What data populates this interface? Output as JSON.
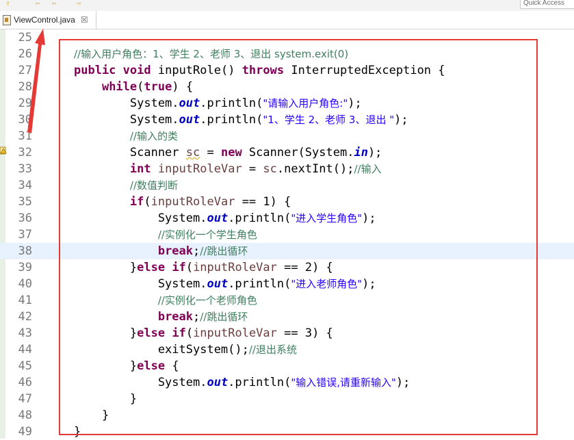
{
  "quick_access": {
    "placeholder": "Quick Access"
  },
  "tab": {
    "label": "ViewControl.java",
    "close_glyph": "☒"
  },
  "lines": [
    {
      "num": "25",
      "segs": []
    },
    {
      "num": "26",
      "segs": [
        {
          "c": "cm",
          "t": "//输入用户角色：1、学生 2、老师 3、退出 system.exit(0)"
        }
      ]
    },
    {
      "num": "27",
      "segs": [
        {
          "c": "kw",
          "t": "public"
        },
        {
          "c": "",
          "t": " "
        },
        {
          "c": "kw",
          "t": "void"
        },
        {
          "c": "",
          "t": " inputRole() "
        },
        {
          "c": "kw",
          "t": "throws"
        },
        {
          "c": "",
          "t": " InterruptedException {"
        }
      ]
    },
    {
      "num": "28",
      "segs": [
        {
          "c": "",
          "t": "    "
        },
        {
          "c": "kw",
          "t": "while"
        },
        {
          "c": "",
          "t": "("
        },
        {
          "c": "kw",
          "t": "true"
        },
        {
          "c": "",
          "t": ") {"
        }
      ]
    },
    {
      "num": "29",
      "segs": [
        {
          "c": "",
          "t": "        System."
        },
        {
          "c": "fld",
          "t": "out"
        },
        {
          "c": "",
          "t": ".println("
        },
        {
          "c": "str",
          "t": "\"请输入用户角色:\""
        },
        {
          "c": "",
          "t": ");"
        }
      ]
    },
    {
      "num": "30",
      "segs": [
        {
          "c": "",
          "t": "        System."
        },
        {
          "c": "fld",
          "t": "out"
        },
        {
          "c": "",
          "t": ".println("
        },
        {
          "c": "str",
          "t": "\"1、学生 2、老师 3、退出 \""
        },
        {
          "c": "",
          "t": ");"
        }
      ]
    },
    {
      "num": "31",
      "segs": [
        {
          "c": "",
          "t": "        "
        },
        {
          "c": "cm",
          "t": "//输入的类"
        }
      ]
    },
    {
      "num": "32",
      "segs": [
        {
          "c": "",
          "t": "        Scanner "
        },
        {
          "c": "var warn",
          "t": "sc"
        },
        {
          "c": "",
          "t": " = "
        },
        {
          "c": "kw",
          "t": "new"
        },
        {
          "c": "",
          "t": " Scanner(System."
        },
        {
          "c": "fld",
          "t": "in"
        },
        {
          "c": "",
          "t": ");"
        }
      ]
    },
    {
      "num": "33",
      "segs": [
        {
          "c": "",
          "t": "        "
        },
        {
          "c": "kw",
          "t": "int"
        },
        {
          "c": "",
          "t": " "
        },
        {
          "c": "var",
          "t": "inputRoleVar"
        },
        {
          "c": "",
          "t": " = "
        },
        {
          "c": "var",
          "t": "sc"
        },
        {
          "c": "",
          "t": ".nextInt();"
        },
        {
          "c": "cm",
          "t": "//输入"
        }
      ]
    },
    {
      "num": "34",
      "segs": [
        {
          "c": "",
          "t": "        "
        },
        {
          "c": "cm",
          "t": "//数值判断"
        }
      ]
    },
    {
      "num": "35",
      "segs": [
        {
          "c": "",
          "t": "        "
        },
        {
          "c": "kw",
          "t": "if"
        },
        {
          "c": "",
          "t": "("
        },
        {
          "c": "var",
          "t": "inputRoleVar"
        },
        {
          "c": "",
          "t": " == 1) {"
        }
      ]
    },
    {
      "num": "36",
      "segs": [
        {
          "c": "",
          "t": "            System."
        },
        {
          "c": "fld",
          "t": "out"
        },
        {
          "c": "",
          "t": ".println("
        },
        {
          "c": "str",
          "t": "\"进入学生角色\""
        },
        {
          "c": "",
          "t": ");"
        }
      ]
    },
    {
      "num": "37",
      "segs": [
        {
          "c": "",
          "t": "            "
        },
        {
          "c": "cm",
          "t": "//实例化一个学生角色"
        }
      ]
    },
    {
      "num": "38",
      "segs": [
        {
          "c": "",
          "t": "            "
        },
        {
          "c": "kw",
          "t": "break"
        },
        {
          "c": "",
          "t": ";"
        },
        {
          "c": "cm",
          "t": "//跳出循环"
        }
      ]
    },
    {
      "num": "39",
      "segs": [
        {
          "c": "",
          "t": "        }"
        },
        {
          "c": "kw",
          "t": "else"
        },
        {
          "c": "",
          "t": " "
        },
        {
          "c": "kw",
          "t": "if"
        },
        {
          "c": "",
          "t": "("
        },
        {
          "c": "var",
          "t": "inputRoleVar"
        },
        {
          "c": "",
          "t": " == 2) {"
        }
      ]
    },
    {
      "num": "40",
      "segs": [
        {
          "c": "",
          "t": "            System."
        },
        {
          "c": "fld",
          "t": "out"
        },
        {
          "c": "",
          "t": ".println("
        },
        {
          "c": "str",
          "t": "\"进入老师角色\""
        },
        {
          "c": "",
          "t": ");"
        }
      ]
    },
    {
      "num": "41",
      "segs": [
        {
          "c": "",
          "t": "            "
        },
        {
          "c": "cm",
          "t": "//实例化一个老师角色"
        }
      ]
    },
    {
      "num": "42",
      "segs": [
        {
          "c": "",
          "t": "            "
        },
        {
          "c": "kw",
          "t": "break"
        },
        {
          "c": "",
          "t": ";"
        },
        {
          "c": "cm",
          "t": "//跳出循环"
        }
      ]
    },
    {
      "num": "43",
      "segs": [
        {
          "c": "",
          "t": "        }"
        },
        {
          "c": "kw",
          "t": "else"
        },
        {
          "c": "",
          "t": " "
        },
        {
          "c": "kw",
          "t": "if"
        },
        {
          "c": "",
          "t": "("
        },
        {
          "c": "var",
          "t": "inputRoleVar"
        },
        {
          "c": "",
          "t": " == 3) {"
        }
      ]
    },
    {
      "num": "44",
      "segs": [
        {
          "c": "",
          "t": "            exitSystem();"
        },
        {
          "c": "cm",
          "t": "//退出系统"
        }
      ]
    },
    {
      "num": "45",
      "segs": [
        {
          "c": "",
          "t": "        }"
        },
        {
          "c": "kw",
          "t": "else"
        },
        {
          "c": "",
          "t": " {"
        }
      ]
    },
    {
      "num": "46",
      "segs": [
        {
          "c": "",
          "t": "            System."
        },
        {
          "c": "fld",
          "t": "out"
        },
        {
          "c": "",
          "t": ".println("
        },
        {
          "c": "str",
          "t": "\"输入错误,请重新输入\""
        },
        {
          "c": "",
          "t": ");"
        }
      ]
    },
    {
      "num": "47",
      "segs": [
        {
          "c": "",
          "t": "        }"
        }
      ]
    },
    {
      "num": "48",
      "segs": [
        {
          "c": "",
          "t": "    }"
        }
      ]
    },
    {
      "num": "49",
      "segs": [
        {
          "c": "",
          "t": "}"
        }
      ]
    }
  ],
  "current_line": "38",
  "warning_line": "32",
  "colors": {
    "annotation_red": "#e53935",
    "keyword": "#7f0055",
    "string": "#2a00ff",
    "comment": "#3f7f5f",
    "field": "#0000c0",
    "current_line_bg": "#e8f2fe"
  }
}
